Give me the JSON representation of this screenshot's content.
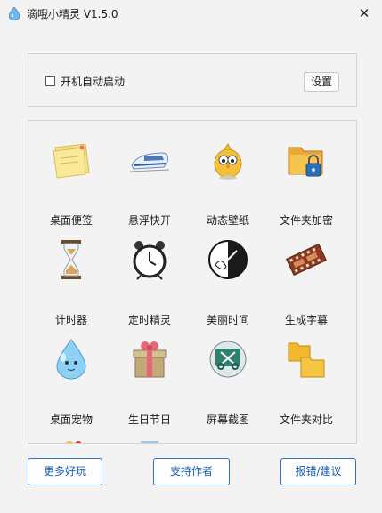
{
  "window": {
    "title": "滴哦小精灵 V1.5.0",
    "close_icon": "close-icon"
  },
  "startup": {
    "checkbox_label": "开机自动启动",
    "checked": false,
    "settings_label": "设置"
  },
  "tools": [
    {
      "label": "桌面便签",
      "icon": "sticky-note-icon"
    },
    {
      "label": "悬浮快开",
      "icon": "bullet-train-icon"
    },
    {
      "label": "动态壁纸",
      "icon": "chick-icon"
    },
    {
      "label": "文件夹加密",
      "icon": "locked-folder-icon"
    },
    {
      "label": "计时器",
      "icon": "hourglass-icon"
    },
    {
      "label": "定时精灵",
      "icon": "alarm-clock-icon"
    },
    {
      "label": "美丽时间",
      "icon": "clock-face-icon"
    },
    {
      "label": "生成字幕",
      "icon": "film-strip-icon"
    },
    {
      "label": "桌面宠物",
      "icon": "water-drop-pet-icon"
    },
    {
      "label": "生日节日",
      "icon": "gift-box-icon"
    },
    {
      "label": "屏幕截图",
      "icon": "screenshot-scissors-icon"
    },
    {
      "label": "文件夹对比",
      "icon": "folder-compare-icon"
    }
  ],
  "footer": {
    "more_label": "更多好玩",
    "support_label": "支持作者",
    "report_label": "报错/建议"
  }
}
